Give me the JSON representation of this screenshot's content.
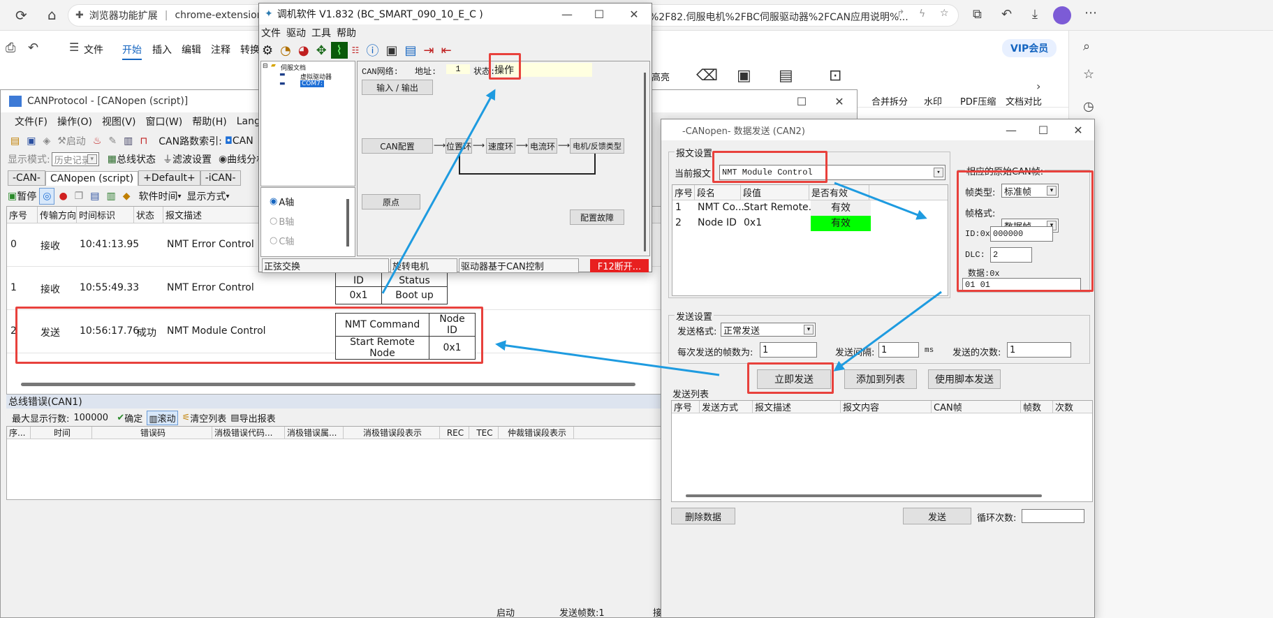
{
  "browser": {
    "ext_label": "浏览器功能扩展",
    "url_start": "chrome-extension://b",
    "url_end": "%2F82.伺服电机%2FBC伺服驱动器%2FCAN应用说明%..."
  },
  "reader": {
    "menu": [
      "文件",
      "开始",
      "插入",
      "编辑",
      "注释",
      "转换"
    ],
    "vip": "VIP会员",
    "right_tools": [
      "高亮",
      "合并拆分",
      "水印",
      "PDF压缩",
      "文档对比"
    ]
  },
  "canprotocol": {
    "title": "CANProtocol - [CANopen (script)]",
    "menu": [
      "文件(F)",
      "操作(O)",
      "视图(V)",
      "窗口(W)",
      "帮助(H)",
      "Language"
    ],
    "toolbar_start": "启动",
    "route_label": "CAN路数索引:",
    "route_value": "CAN",
    "mode_label": "显示模式:",
    "mode_value": "历史记录",
    "bus_status": "总线状态",
    "filter": "滤波设置",
    "curve": "曲线分析",
    "tabs": [
      "-CAN-",
      "CANopen (script)",
      "+Default+",
      "-iCAN-"
    ],
    "toolbar2": {
      "pause": "暂停",
      "soft_time": "软件时间",
      "display": "显示方式"
    },
    "cols": [
      "序号",
      "传输方向",
      "时间标识",
      "状态",
      "报文描述"
    ],
    "rows": [
      {
        "idx": "0",
        "dir": "接收",
        "time": "10:41:13.95",
        "status": "",
        "desc": "NMT Error Control"
      },
      {
        "idx": "1",
        "dir": "接收",
        "time": "10:55:49.33",
        "status": "",
        "desc": "NMT Error Control"
      },
      {
        "idx": "2",
        "dir": "发送",
        "time": "10:56:17.76",
        "status": "成功",
        "desc": "NMT Module Control"
      }
    ],
    "row1_table": {
      "h1": "Node ID",
      "h2": "Node Status",
      "v1": "0x1",
      "v2": "Boot up"
    },
    "row2_table": {
      "h1": "NMT Command",
      "h2": "Node ID",
      "v1": "Start Remote Node",
      "v2": "0x1"
    },
    "err_title": "总线错误(CAN1)",
    "err_max_label": "最大显示行数:",
    "err_max_value": "100000",
    "err_confirm": "确定",
    "err_scroll": "滚动",
    "err_clear": "清空列表",
    "err_export": "导出报表",
    "err_cols": [
      "序...",
      "时间",
      "错误码",
      "消极错误代码...",
      "消极错误属...",
      "消极错误段表示",
      "REC",
      "TEC",
      "仲裁错误段表示"
    ],
    "status_start": "启动",
    "status_count": "发送帧数:1",
    "status_tail": "接"
  },
  "tuning": {
    "title": "调机软件 V1.832 (BC_SMART_090_10_E_C )",
    "menu": [
      "文件",
      "驱动",
      "工具",
      "帮助"
    ],
    "tree_root": "伺服文档",
    "tree_child1": "虚拟驱动器",
    "tree_child2": "COM7:",
    "net_label": "CAN网络:",
    "addr_label": "地址:",
    "addr_value": "1",
    "state_label": "状态:",
    "state_value": "操作",
    "io_button": "输入 / 输出",
    "can_config": "CAN配置",
    "pos_loop": "位置环",
    "speed_loop": "速度环",
    "current_loop": "电流环",
    "motor_fb": "电机/反馈类型",
    "origin": "原点",
    "fault": "配置故障",
    "axes": [
      "A轴",
      "B轴",
      "C轴"
    ],
    "status_bar": [
      "正弦交换",
      "旋转电机",
      "驱动器基于CAN控制",
      "F12断开..."
    ]
  },
  "send": {
    "title": "-CANopen- 数据发送 (CAN2)",
    "frame_group": "报文设置",
    "current_label": "当前报文",
    "current_value": "NMT Module Control",
    "table_cols": [
      "序号",
      "段名",
      "段值",
      "是否有效"
    ],
    "table_rows": [
      {
        "idx": "1",
        "name": "NMT Co...",
        "value": "Start Remote...",
        "valid": "有效"
      },
      {
        "idx": "2",
        "name": "Node ID",
        "value": "0x1",
        "valid": "有效"
      }
    ],
    "raw_group": "相应的原始CAN帧:",
    "type_label": "帧类型:",
    "type_value": "标准帧",
    "fmt_label": "帧格式:",
    "fmt_value": "数据帧",
    "id_label": "ID:0x",
    "id_value": "000000",
    "dlc_label": "DLC:",
    "dlc_value": "2",
    "data_label": "数据:0x",
    "data_value": "01 01",
    "send_group": "发送设置",
    "send_fmt_label": "发送格式:",
    "send_fmt_value": "正常发送",
    "per_label": "每次发送的帧数为:",
    "per_value": "1",
    "interval_label": "发送间隔:",
    "interval_value": "1",
    "interval_unit": "ms",
    "times_label": "发送的次数:",
    "times_value": "1",
    "btn_now": "立即发送",
    "btn_add": "添加到列表",
    "btn_script": "使用脚本发送",
    "list_label": "发送列表",
    "list_cols": [
      "序号",
      "发送方式",
      "报文描述",
      "报文内容",
      "CAN帧",
      "帧数",
      "次数"
    ],
    "btn_delete": "删除数据",
    "btn_send": "发送",
    "loop_label": "循环次数:"
  },
  "colors": {
    "annotation_red": "#e8413c",
    "arrow_blue": "#1e9be0",
    "valid_green": "#00ff00"
  }
}
